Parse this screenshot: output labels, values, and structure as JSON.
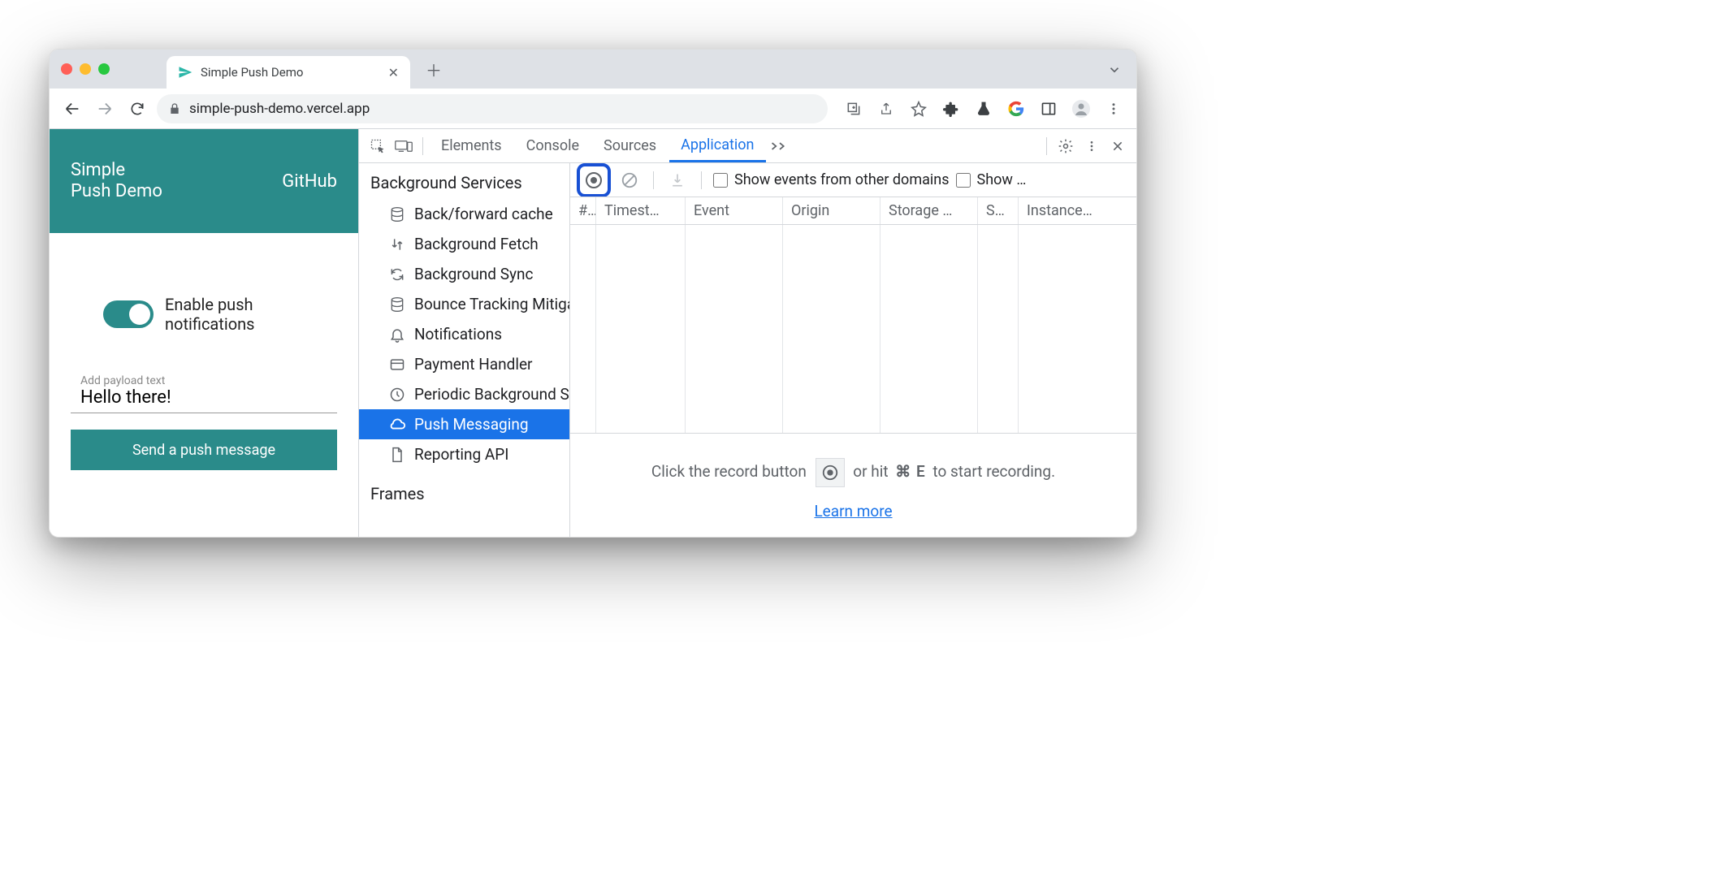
{
  "browser": {
    "tab_title": "Simple Push Demo",
    "url": "simple-push-demo.vercel.app"
  },
  "page": {
    "title_line1": "Simple",
    "title_line2": "Push Demo",
    "github_link": "GitHub",
    "toggle_label_line1": "Enable push",
    "toggle_label_line2": "notifications",
    "payload_label": "Add payload text",
    "payload_value": "Hello there!",
    "send_button": "Send a push message"
  },
  "devtools": {
    "tabs": {
      "elements": "Elements",
      "console": "Console",
      "sources": "Sources",
      "application": "Application"
    },
    "sidebar": {
      "section_bg_services": "Background Services",
      "items": {
        "back_forward_cache": "Back/forward cache",
        "background_fetch": "Background Fetch",
        "background_sync": "Background Sync",
        "bounce_tracking": "Bounce Tracking Mitigations",
        "notifications": "Notifications",
        "payment_handler": "Payment Handler",
        "periodic_background": "Periodic Background Sync",
        "push_messaging": "Push Messaging",
        "reporting_api": "Reporting API"
      },
      "section_frames": "Frames"
    },
    "action_bar": {
      "show_other_domains": "Show events from other domains",
      "show_truncated": "Show …"
    },
    "table": {
      "headers": {
        "num": "#",
        "timestamp": "Timest…",
        "event": "Event",
        "origin": "Origin",
        "storage": "Storage …",
        "sw": "S…",
        "instance": "Instance…"
      }
    },
    "empty": {
      "prefix": "Click the record button",
      "suffix_before_key": "or hit",
      "key": "⌘ E",
      "suffix_after_key": "to start recording.",
      "learn_more": "Learn more"
    }
  }
}
